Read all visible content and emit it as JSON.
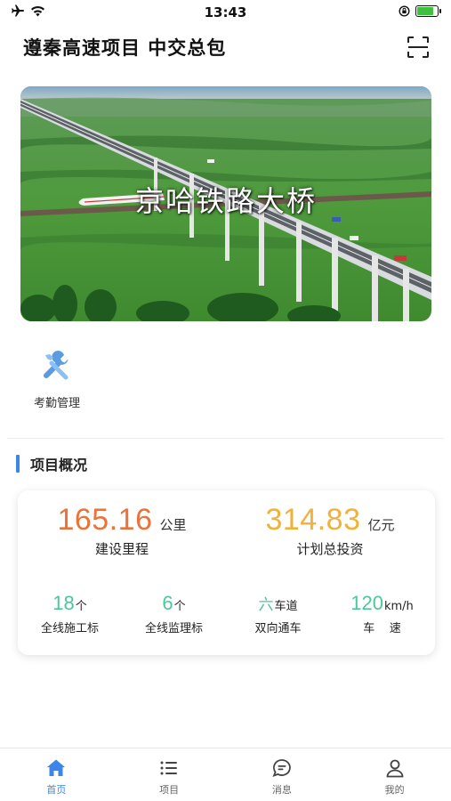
{
  "status_bar": {
    "time": "13:43",
    "icons": [
      "airplane-icon",
      "wifi-icon",
      "orientation-lock-icon",
      "battery-icon"
    ],
    "battery_level": 0.8,
    "battery_color": "#3cc23c"
  },
  "header": {
    "title": "遵秦高速项目  中交总包",
    "scan_icon": "scan-icon"
  },
  "banner": {
    "caption": "京哈铁路大桥"
  },
  "functions": [
    {
      "label": "考勤管理",
      "icon": "wrench-screwdriver-icon"
    }
  ],
  "section": {
    "title": "项目概况",
    "accent": "#3b86e8"
  },
  "stats": {
    "length": {
      "value": "165.16",
      "unit": "公里",
      "label": "建设里程",
      "color": "#e9733a"
    },
    "investment": {
      "value": "314.83",
      "unit": "亿元",
      "label": "计划总投资",
      "color": "#efb23a"
    },
    "construction_sections": {
      "value": "18",
      "unit": "个",
      "label": "全线施工标"
    },
    "supervision_sections": {
      "value": "6",
      "unit": "个",
      "label": "全线监理标"
    },
    "lanes": {
      "value": "六",
      "unit": "车道",
      "label": "双向通车"
    },
    "speed": {
      "value": "120",
      "unit": "km/h",
      "label": "车    速"
    },
    "small_color": "#4cc79a"
  },
  "tabs": [
    {
      "label": "首页",
      "icon": "home-icon",
      "active": true
    },
    {
      "label": "项目",
      "icon": "list-icon",
      "active": false
    },
    {
      "label": "消息",
      "icon": "message-icon",
      "active": false
    },
    {
      "label": "我的",
      "icon": "user-icon",
      "active": false
    }
  ],
  "active_color": "#3b86e8"
}
